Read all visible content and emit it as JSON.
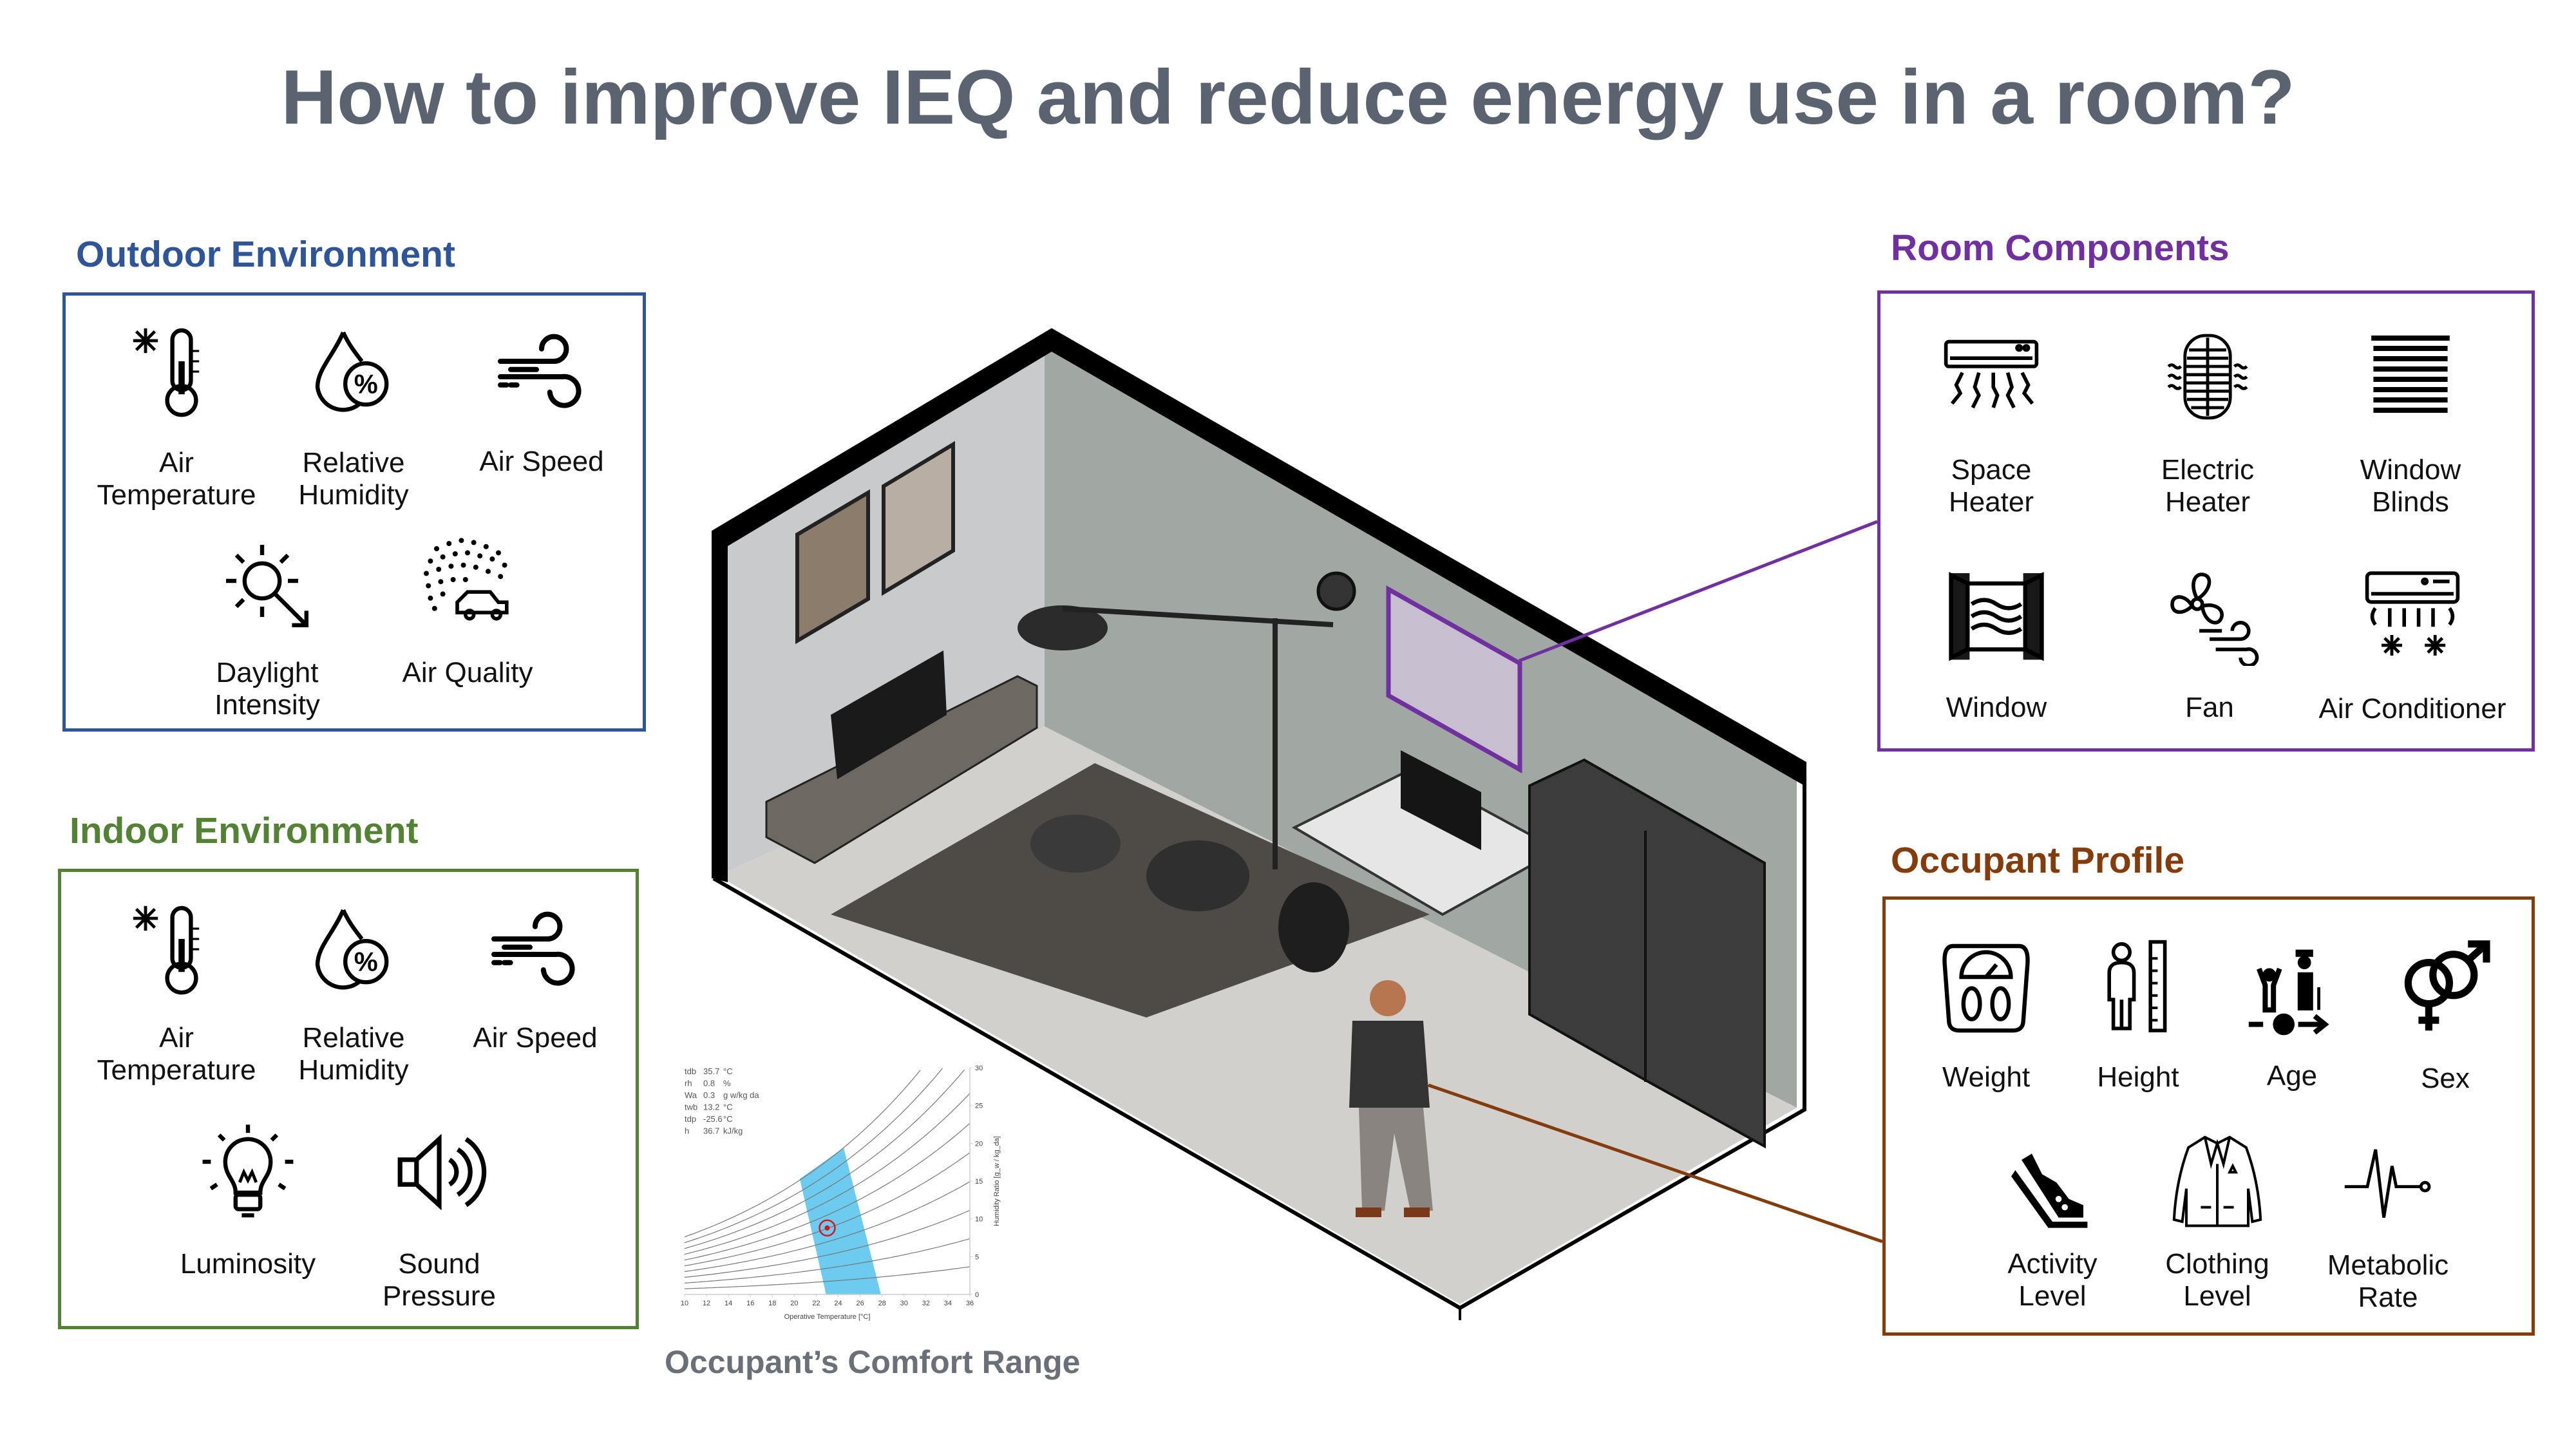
{
  "title": "How to improve IEQ and reduce energy use in a room?",
  "colors": {
    "title": "#5b6370",
    "outdoor": "#2e5597",
    "indoor": "#548235",
    "room": "#7030a0",
    "occupant": "#843c0c",
    "comfort_zone": "#6ccbef",
    "point": "#d9141b"
  },
  "outdoor": {
    "heading": "Outdoor Environment",
    "items": [
      {
        "label1": "Air",
        "label2": "Temperature",
        "icon": "thermometer-snowflake-icon"
      },
      {
        "label1": "Relative",
        "label2": "Humidity",
        "icon": "humidity-drop-icon"
      },
      {
        "label1": "Air Speed",
        "icon": "wind-icon"
      },
      {
        "label1": "Daylight",
        "label2": "Intensity",
        "icon": "sun-icon"
      },
      {
        "label1": "Air Quality",
        "icon": "air-quality-car-icon"
      }
    ]
  },
  "indoor": {
    "heading": "Indoor Environment",
    "items": [
      {
        "label1": "Air",
        "label2": "Temperature",
        "icon": "thermometer-snowflake-icon"
      },
      {
        "label1": "Relative",
        "label2": "Humidity",
        "icon": "humidity-drop-icon"
      },
      {
        "label1": "Air Speed",
        "icon": "wind-icon"
      },
      {
        "label1": "Luminosity",
        "icon": "light-bulb-icon"
      },
      {
        "label1": "Sound",
        "label2": "Pressure",
        "icon": "speaker-icon"
      }
    ]
  },
  "room": {
    "heading": "Room Components",
    "items": [
      {
        "label1": "Space",
        "label2": "Heater",
        "icon": "space-heater-icon"
      },
      {
        "label1": "Electric",
        "label2": "Heater",
        "icon": "electric-heater-icon"
      },
      {
        "label1": "Window",
        "label2": "Blinds",
        "icon": "window-blinds-icon"
      },
      {
        "label1": "Window",
        "icon": "window-icon"
      },
      {
        "label1": "Fan",
        "icon": "fan-icon"
      },
      {
        "label1": "Air Conditioner",
        "icon": "air-conditioner-icon"
      }
    ]
  },
  "occupant": {
    "heading": "Occupant Profile",
    "items": [
      {
        "label1": "Weight",
        "icon": "scale-icon"
      },
      {
        "label1": "Height",
        "icon": "height-ruler-icon"
      },
      {
        "label1": "Age",
        "icon": "age-icon"
      },
      {
        "label1": "Sex",
        "icon": "gender-icon"
      },
      {
        "label1": "Activity",
        "label2": "Level",
        "icon": "shoe-icon"
      },
      {
        "label1": "Clothing",
        "label2": "Level",
        "icon": "jacket-icon"
      },
      {
        "label1": "Metabolic",
        "label2": "Rate",
        "icon": "heartbeat-icon"
      }
    ]
  },
  "comfort_caption": "Occupant’s Comfort Range",
  "chart_data": {
    "type": "line",
    "xlabel": "Operative Temperature [°C]",
    "ylabel": "Humidity Ratio [g_w / kg_da]",
    "xlim": [
      10,
      36
    ],
    "ylim": [
      0,
      30
    ],
    "xticks": [
      10,
      12,
      14,
      16,
      18,
      20,
      22,
      24,
      26,
      28,
      30,
      32,
      34,
      36
    ],
    "yticks": [
      0,
      5,
      10,
      15,
      20,
      25,
      30
    ],
    "rh_lines_percent": [
      10,
      20,
      30,
      40,
      50,
      60,
      70,
      80,
      90,
      100
    ],
    "comfort_zone": [
      [
        20.5,
        15.3
      ],
      [
        24.5,
        19.4
      ],
      [
        27.9,
        0
      ],
      [
        22.9,
        0
      ]
    ],
    "point": [
      23,
      8.8
    ],
    "readouts": [
      {
        "name": "tdb",
        "value": "35.7",
        "unit": "°C"
      },
      {
        "name": "rh",
        "value": "0.8",
        "unit": "%"
      },
      {
        "name": "Wa",
        "value": "0.3",
        "unit": "g w/kg da"
      },
      {
        "name": "twb",
        "value": "13.2",
        "unit": "°C"
      },
      {
        "name": "tdp",
        "value": "-25.6",
        "unit": "°C"
      },
      {
        "name": "h",
        "value": "36.7",
        "unit": "kJ/kg"
      }
    ]
  }
}
